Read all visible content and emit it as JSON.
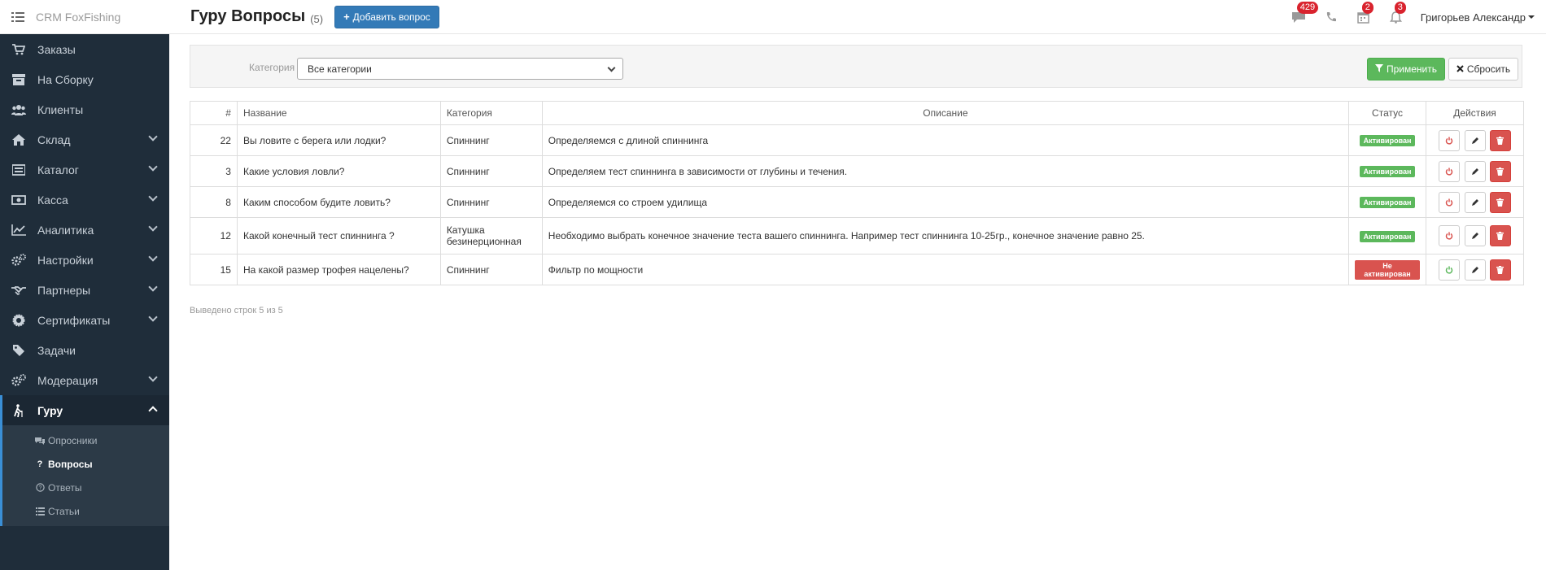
{
  "brand": {
    "title": "CRM FoxFishing"
  },
  "sidebar": {
    "items": [
      {
        "label": "Заказы",
        "icon": "cart-icon",
        "has_children": false
      },
      {
        "label": "На Сборку",
        "icon": "box-icon",
        "has_children": false
      },
      {
        "label": "Клиенты",
        "icon": "users-icon",
        "has_children": false
      },
      {
        "label": "Склад",
        "icon": "home-icon",
        "has_children": true
      },
      {
        "label": "Каталог",
        "icon": "catalog-icon",
        "has_children": true
      },
      {
        "label": "Касса",
        "icon": "money-icon",
        "has_children": true
      },
      {
        "label": "Аналитика",
        "icon": "chart-icon",
        "has_children": true
      },
      {
        "label": "Настройки",
        "icon": "gears-icon",
        "has_children": true
      },
      {
        "label": "Партнеры",
        "icon": "handshake-icon",
        "has_children": true
      },
      {
        "label": "Сертификаты",
        "icon": "certificate-icon",
        "has_children": true
      },
      {
        "label": "Задачи",
        "icon": "tag-icon",
        "has_children": false
      },
      {
        "label": "Модерация",
        "icon": "gears-icon",
        "has_children": true
      },
      {
        "label": "Гуру",
        "icon": "walking-icon",
        "has_children": true,
        "active": true
      }
    ],
    "submenu": [
      {
        "label": "Опросники",
        "icon": "comments-icon"
      },
      {
        "label": "Вопросы",
        "icon": "question-icon",
        "current": true
      },
      {
        "label": "Ответы",
        "icon": "question-circle-icon"
      },
      {
        "label": "Статьи",
        "icon": "list-icon"
      }
    ]
  },
  "header": {
    "title": "Гуру Вопросы",
    "count": "(5)",
    "add_button": "Добавить вопрос",
    "messages_badge": "429",
    "calendar_badge": "2",
    "notifications_badge": "3",
    "user_name": "Григорьев Александр"
  },
  "filter": {
    "category_label": "Категория",
    "category_value": "Все категории",
    "apply_label": "Применить",
    "reset_label": "Сбросить"
  },
  "table": {
    "columns": [
      "#",
      "Название",
      "Категория",
      "Описание",
      "Статус",
      "Действия"
    ],
    "rows": [
      {
        "id": "22",
        "name": "Вы ловите с берега или лодки?",
        "category": "Спиннинг",
        "description": "Определяемся с длиной спиннинга",
        "status": "Активирован",
        "active": true
      },
      {
        "id": "3",
        "name": "Какие условия ловли?",
        "category": "Спиннинг",
        "description": "Определяем тест спиннинга в зависимости от глубины и течения.",
        "status": "Активирован",
        "active": true
      },
      {
        "id": "8",
        "name": "Каким способом будите ловить?",
        "category": "Спиннинг",
        "description": "Определяемся со строем удилища",
        "status": "Активирован",
        "active": true
      },
      {
        "id": "12",
        "name": "Какой конечный тест спиннинга ?",
        "category": "Катушка безинерционная",
        "description": "Необходимо выбрать конечное значение теста вашего спиннинга. Например тест спиннинга 10-25гр., конечное значение равно 25.",
        "status": "Активирован",
        "active": true
      },
      {
        "id": "15",
        "name": "На какой размер трофея нацелены?",
        "category": "Спиннинг",
        "description": "Фильтр по мощности",
        "status": "Не активирован",
        "active": false
      }
    ]
  },
  "footer": {
    "summary": "Выведено строк 5 из 5"
  },
  "colors": {
    "sidebar_bg": "#1f2d3a",
    "primary": "#337ab7",
    "success": "#5cb85c",
    "danger": "#d9534f",
    "badge": "#d9232e"
  }
}
